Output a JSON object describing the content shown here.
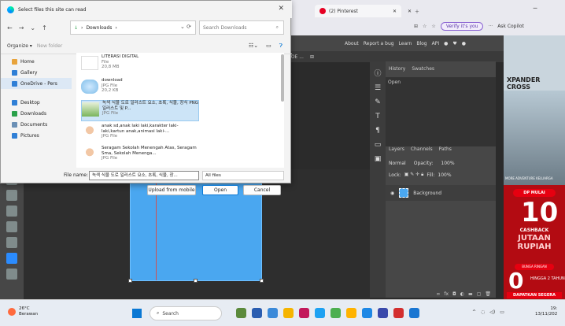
{
  "browser": {
    "tab_pinterest": "(2) Pinterest",
    "verify_pill": "Verify it's you",
    "copilot": "Ask Copilot"
  },
  "photopea": {
    "menu": [
      "About",
      "Report a bug",
      "Learn",
      "Blog",
      "API"
    ],
    "doc_tab": "3OE ...",
    "history_tabs": [
      "History",
      "Swatches"
    ],
    "history_items": [
      "Open"
    ],
    "layers_tabs": [
      "Layers",
      "Channels",
      "Paths"
    ],
    "blend_mode": "Normal",
    "opacity_label": "Opacity:",
    "opacity_value": "100%",
    "lock_label": "Lock:",
    "fill_label": "Fill:",
    "fill_value": "100%",
    "layer_name": "Background"
  },
  "ad": {
    "brand": "XPANDER CROSS",
    "photo_caption": "MORE ADVENTURE KELUARGA",
    "pill": "DP MULAI",
    "big_number": "10",
    "cashback": "CASHBACK",
    "jutaan": "JUTAAN RUPIAH",
    "bunga": "BUNGA RINGAN",
    "zero": "0",
    "hingga": "HINGGA 2 TAHUN",
    "cta": "DAPATKAN SEGERA"
  },
  "dialog": {
    "title": "Select files this site can read",
    "path": "Downloads",
    "search_placeholder": "Search Downloads",
    "organize": "Organize ▾",
    "new_folder": "New folder",
    "sidebar": [
      {
        "label": "Home",
        "color": "#e8a33a"
      },
      {
        "label": "Gallery",
        "color": "#2f7fd6"
      },
      {
        "label": "OneDrive - Pers",
        "color": "#2f7fd6"
      },
      {
        "label": "Desktop",
        "color": "#2f7fd6"
      },
      {
        "label": "Downloads",
        "color": "#2aa14a"
      },
      {
        "label": "Documents",
        "color": "#6a8fb5"
      },
      {
        "label": "Pictures",
        "color": "#2f7fd6"
      }
    ],
    "files": [
      {
        "name": "LITERASI DIGITAL",
        "type": "File",
        "size": "20,8 MB"
      },
      {
        "name": "download",
        "type": "JPG File",
        "size": "20,2 KB"
      },
      {
        "name": "녹색 식물 도로 일러스트 요소, 초록, 식물, 장식 PNG 일러스트 및 P...",
        "type": "JPG File",
        "size": ""
      },
      {
        "name": "anak sd,anak laki laki,karakter laki-laki,kartun anak,animasi laki-...",
        "type": "JPG File",
        "size": ""
      },
      {
        "name": "Seragam Sekolah Menengah Atas, Seragam Sma, Sekolah Menenga...",
        "type": "JPG File",
        "size": ""
      }
    ],
    "filename_label": "File name:",
    "filename_value": "녹색 식물 도로 일러스트 요소, 초록, 식물, 장...",
    "filter": "All files",
    "upload_mobile": "Upload from mobile",
    "open": "Open",
    "cancel": "Cancel"
  },
  "taskbar": {
    "temp": "26°C",
    "weather": "Berawan",
    "search": "Search",
    "time": "19:",
    "date": "13/11/202"
  }
}
